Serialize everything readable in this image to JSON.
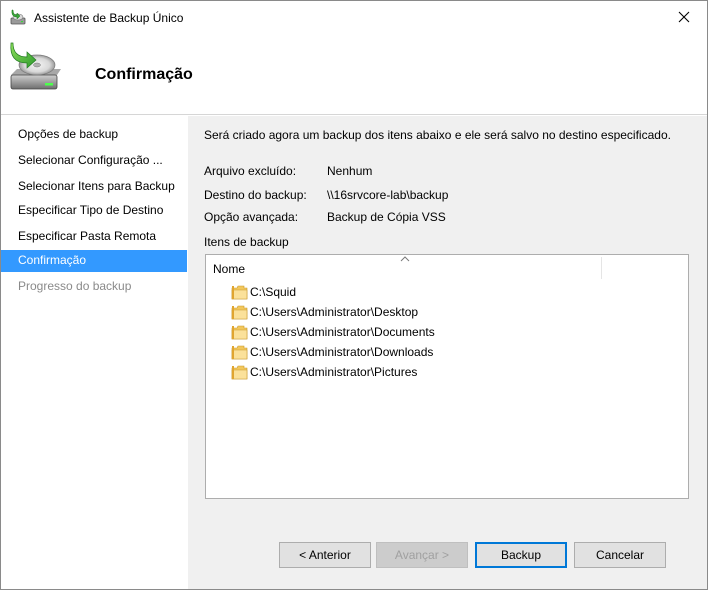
{
  "window": {
    "title": "Assistente de Backup Único"
  },
  "header": {
    "title": "Confirmação"
  },
  "steps": [
    {
      "label": "Opções de backup",
      "state": "normal"
    },
    {
      "label": "Selecionar Configuração ...",
      "state": "normal"
    },
    {
      "label": "Selecionar Itens para Backup",
      "state": "normal"
    },
    {
      "label": "Especificar Tipo de Destino",
      "state": "normal"
    },
    {
      "label": "Especificar Pasta Remota",
      "state": "normal"
    },
    {
      "label": "Confirmação",
      "state": "active"
    },
    {
      "label": "Progresso do backup",
      "state": "disabled"
    }
  ],
  "content": {
    "intro": "Será criado agora um backup dos itens abaixo e ele será salvo no destino especificado.",
    "details": [
      {
        "label": "Arquivo excluído:",
        "value": "Nenhum"
      },
      {
        "label": "Destino do backup:",
        "value": "\\\\16srvcore-lab\\backup"
      },
      {
        "label": "Opção avançada:",
        "value": "Backup de Cópia VSS"
      }
    ],
    "items_label": "Itens de backup",
    "list": {
      "column_name": "Nome",
      "items": [
        "C:\\Squid",
        "C:\\Users\\Administrator\\Desktop",
        "C:\\Users\\Administrator\\Documents",
        "C:\\Users\\Administrator\\Downloads",
        "C:\\Users\\Administrator\\Pictures"
      ]
    }
  },
  "buttons": {
    "back": "< Anterior",
    "next": "Avançar >",
    "backup": "Backup",
    "cancel": "Cancelar"
  },
  "colors": {
    "active_step": "#3399ff",
    "panel": "#f0f0f0",
    "default_button_border": "#0078d7"
  },
  "icons": {
    "title": "backup-drive-icon",
    "header": "backup-drive-large-icon",
    "close": "close-icon",
    "sort": "sort-ascending-icon",
    "item": "folder-icon"
  }
}
